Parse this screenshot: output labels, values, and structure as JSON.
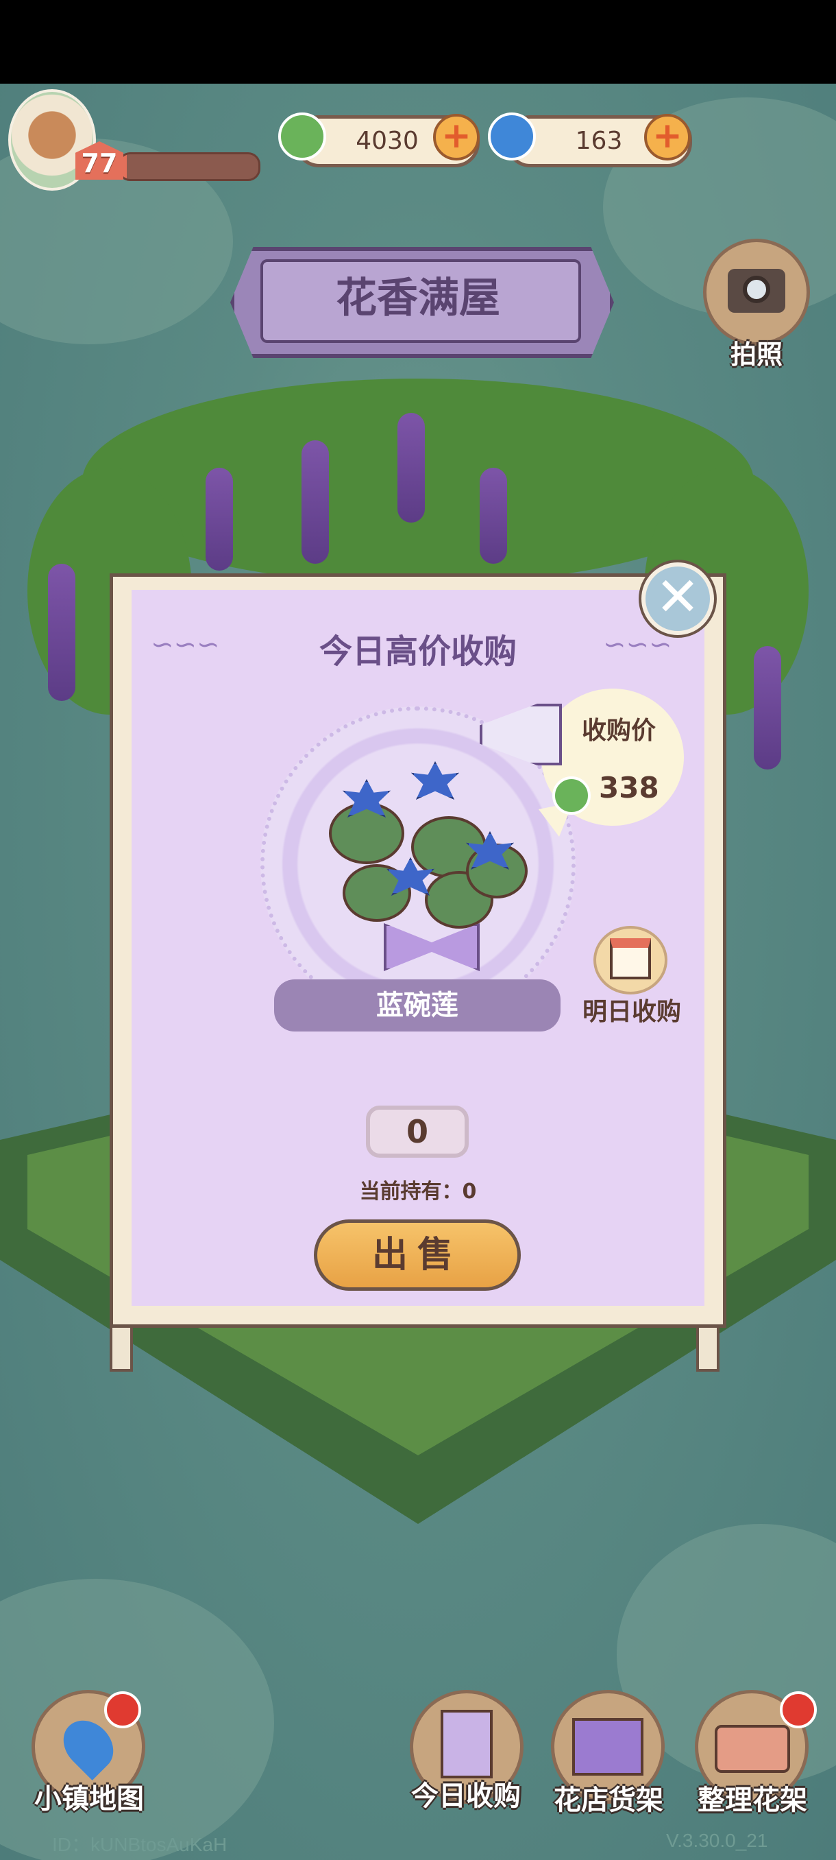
{
  "player": {
    "level": "77",
    "xp_fraction": 0.05
  },
  "currencies": {
    "leaf_coin": "4030",
    "spiral_gem": "163"
  },
  "icons": {
    "leaf_coin": "leaf-coin-icon",
    "spiral_gem": "spiral-gem-icon",
    "plus": "plus-icon",
    "camera": "camera-icon",
    "close": "close-icon",
    "megaphone": "megaphone-icon",
    "calendar": "calendar-icon",
    "map_pin": "map-pin-icon",
    "poster": "poster-icon",
    "stall": "stall-icon",
    "flowerpots": "flowerpots-icon"
  },
  "header": {
    "shop_title": "花香满屋"
  },
  "camera": {
    "label": "拍照"
  },
  "modal": {
    "title": "今日高价收购",
    "close_symbol": "✕",
    "price_label": "收购价",
    "price_value": "338",
    "flower_name": "蓝碗莲",
    "tomorrow_label": "明日收购",
    "quantity": "0",
    "held_text": "当前持有：0",
    "sell_label": "出售"
  },
  "plus_symbol": "+",
  "nav": {
    "town_map": "小镇地图",
    "today_purchase": "今日收购",
    "shop_shelf": "花店货架",
    "arrange_shelf": "整理花架"
  },
  "footer": {
    "id_text": "ID：kUNBtosAuKaH",
    "version": "V.3.30.0_21"
  },
  "colors": {
    "modal_bg": "#e6d3f4",
    "accent_purple": "#6a4f88",
    "sell_button": "#f6c36a",
    "notification": "#e03a30"
  }
}
